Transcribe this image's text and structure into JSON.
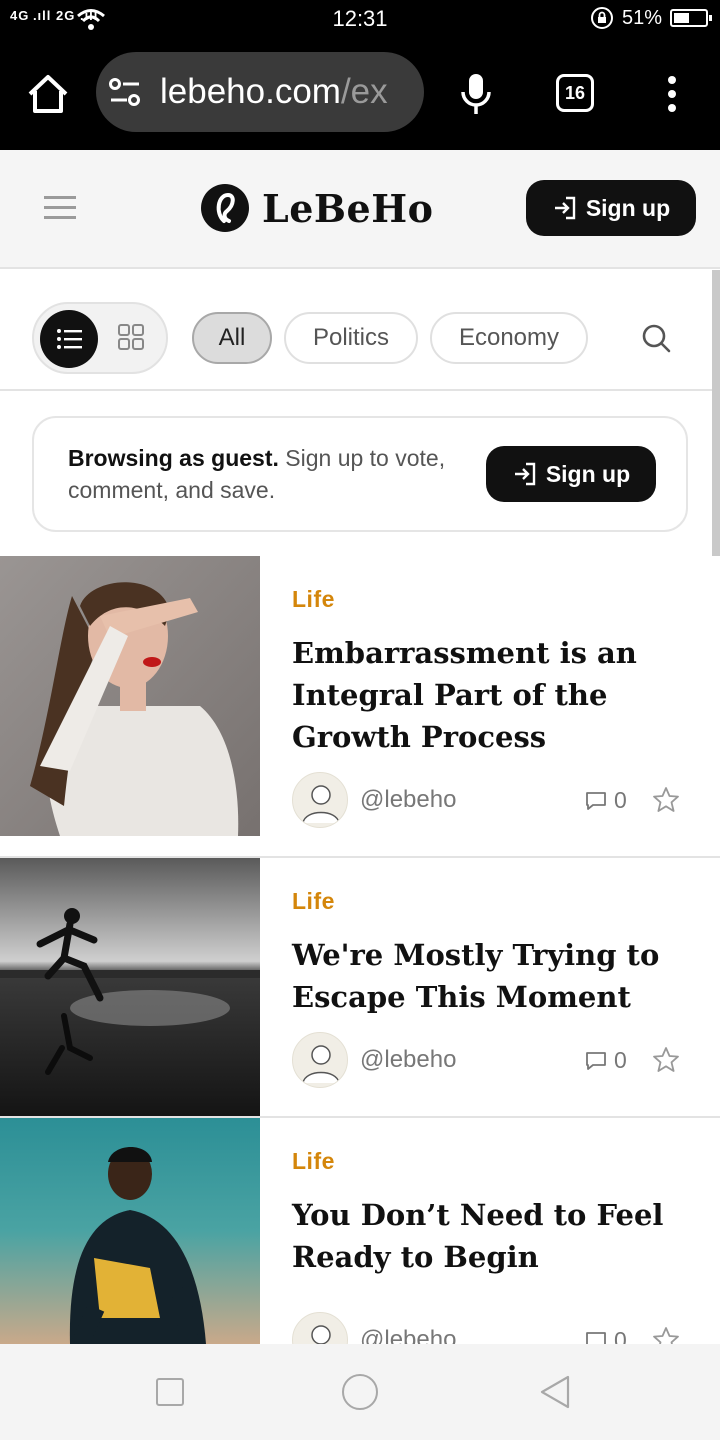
{
  "status_bar": {
    "signal": "4G .ıll 2G .ıll",
    "time": "12:31",
    "battery_percent": "51%",
    "battery_level": 0.51,
    "icons": [
      "signal-icon",
      "wifi-icon",
      "rotation-lock-icon",
      "battery-icon"
    ]
  },
  "browser": {
    "url_main": "lebeho.com",
    "url_rest": "/ex",
    "tab_count": "16",
    "icons": [
      "home-icon",
      "site-settings-icon",
      "mic-icon",
      "more-icon"
    ]
  },
  "site_header": {
    "logo_text": "LeBeHo",
    "signup_label": "Sign up"
  },
  "filters": {
    "chips": [
      "All",
      "Politics",
      "Economy"
    ],
    "active": "All",
    "view_mode": "list"
  },
  "guest_banner": {
    "bold": "Browsing as guest.",
    "text": " Sign up to vote, comment, and save.",
    "signup_label": "Sign up"
  },
  "articles": [
    {
      "category": "Life",
      "title": "Embarrassment is an Integral Part of the Growth Process",
      "author": "@lebeho",
      "comments": "0"
    },
    {
      "category": "Life",
      "title": "We're Mostly Trying to Escape This Moment",
      "author": "@lebeho",
      "comments": "0"
    },
    {
      "category": "Life",
      "title": "You Don’t Need to Feel Ready to Begin",
      "author": "@lebeho",
      "comments": "0"
    }
  ],
  "colors": {
    "accent": "#d4860b",
    "primary_button": "#111111",
    "browser_chrome": "#000000",
    "header_bg": "#f5f5f5"
  }
}
